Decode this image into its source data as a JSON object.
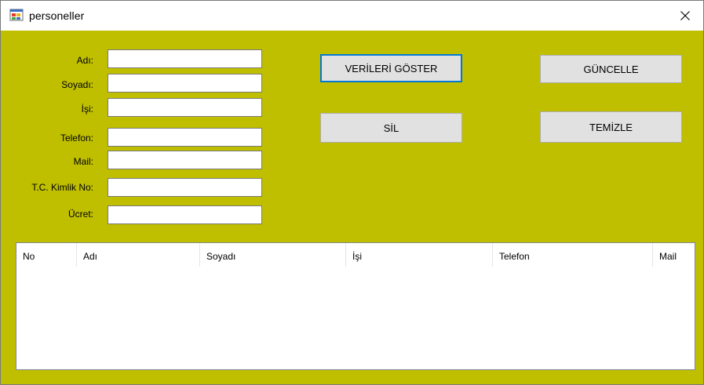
{
  "window": {
    "title": "personeller"
  },
  "form": {
    "fields": [
      {
        "label": "Adı:",
        "value": ""
      },
      {
        "label": "Soyadı:",
        "value": ""
      },
      {
        "label": "İşi:",
        "value": ""
      },
      {
        "label": "Telefon:",
        "value": ""
      },
      {
        "label": "Mail:",
        "value": ""
      },
      {
        "label": "T.C. Kimlik No:",
        "value": ""
      },
      {
        "label": "Ücret:",
        "value": ""
      }
    ]
  },
  "buttons": {
    "show": "VERİLERİ GÖSTER",
    "update": "GÜNCELLE",
    "delete": "SİL",
    "clear": "TEMİZLE"
  },
  "table": {
    "columns": [
      "No",
      "Adı",
      "Soyadı",
      "İşi",
      "Telefon",
      "Mail"
    ]
  },
  "colors": {
    "background": "#bfbf00",
    "focus": "#0078d7"
  },
  "icons": {
    "app": "app-form-icon",
    "close": "close-icon"
  }
}
